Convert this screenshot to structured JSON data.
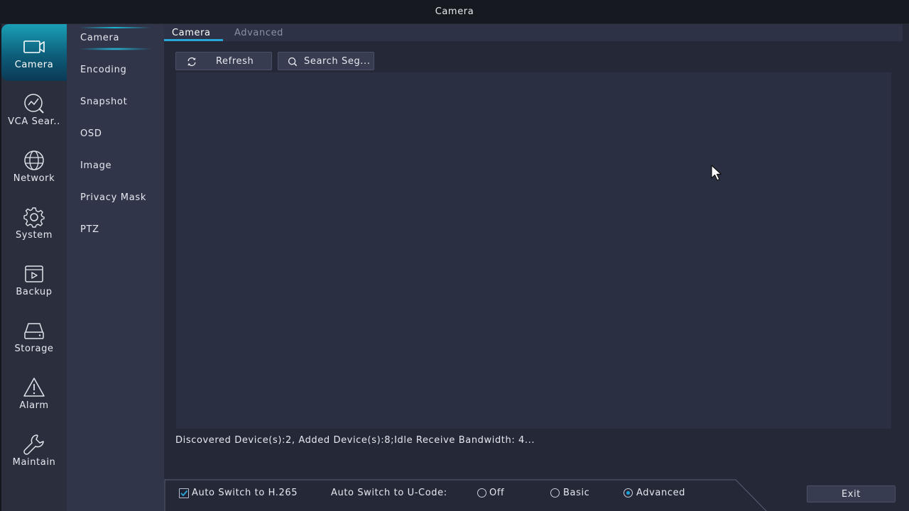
{
  "window": {
    "title": "Camera"
  },
  "left_nav": [
    {
      "label": "Camera",
      "icon": "camera-icon",
      "active": true
    },
    {
      "label": "VCA Sear..",
      "icon": "vca-search-icon",
      "active": false
    },
    {
      "label": "Network",
      "icon": "globe-icon",
      "active": false
    },
    {
      "label": "System",
      "icon": "gear-icon",
      "active": false
    },
    {
      "label": "Backup",
      "icon": "backup-icon",
      "active": false
    },
    {
      "label": "Storage",
      "icon": "storage-icon",
      "active": false
    },
    {
      "label": "Alarm",
      "icon": "alarm-icon",
      "active": false
    },
    {
      "label": "Maintain",
      "icon": "wrench-icon",
      "active": false
    }
  ],
  "sub_nav": [
    {
      "label": "Camera",
      "active": true
    },
    {
      "label": "Encoding",
      "active": false
    },
    {
      "label": "Snapshot",
      "active": false
    },
    {
      "label": "OSD",
      "active": false
    },
    {
      "label": "Image",
      "active": false
    },
    {
      "label": "Privacy Mask",
      "active": false
    },
    {
      "label": "PTZ",
      "active": false
    }
  ],
  "tabs": [
    {
      "label": "Camera",
      "active": true
    },
    {
      "label": "Advanced",
      "active": false
    }
  ],
  "toolbar": {
    "refresh_label": "Refresh",
    "search_label": "Search Seg..."
  },
  "status": {
    "text": "Discovered Device(s):2, Added Device(s):8;Idle Receive Bandwidth: 4..."
  },
  "options": {
    "auto_h265_label": "Auto Switch to H.265",
    "auto_h265_checked": true,
    "ucode_label": "Auto Switch to U-Code:",
    "ucode_options": [
      "Off",
      "Basic",
      "Advanced"
    ],
    "ucode_selected": "Advanced"
  },
  "footer": {
    "exit_label": "Exit"
  },
  "colors": {
    "accent": "#1aa3d8",
    "active_nav": "#0d5e7a",
    "panel": "#2b2f42",
    "background": "#242837"
  }
}
